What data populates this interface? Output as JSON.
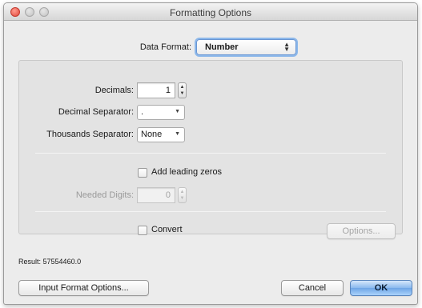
{
  "window": {
    "title": "Formatting Options"
  },
  "data_format": {
    "label": "Data Format:",
    "value": "Number"
  },
  "decimals": {
    "label": "Decimals:",
    "value": "1"
  },
  "decimal_separator": {
    "label": "Decimal Separator:",
    "value": "."
  },
  "thousands_separator": {
    "label": "Thousands Separator:",
    "value": "None"
  },
  "leading_zeros": {
    "label": "Add leading zeros",
    "checked": false
  },
  "needed_digits": {
    "label": "Needed Digits:",
    "value": "0"
  },
  "convert": {
    "label": "Convert",
    "checked": false
  },
  "buttons": {
    "options": "Options...",
    "input_format_options": "Input Format Options...",
    "cancel": "Cancel",
    "ok": "OK"
  },
  "result": {
    "label": "Result:",
    "value": "57554460.0"
  },
  "colors": {
    "default_button": "#6ea5e6",
    "close_button": "#e0473b"
  }
}
